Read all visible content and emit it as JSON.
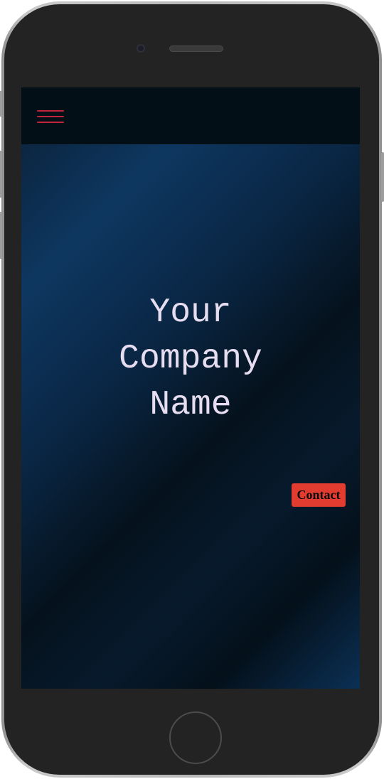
{
  "device": {
    "frame_color": "#b7b7b7",
    "bezel_color": "#232323"
  },
  "site": {
    "nav": {
      "menu_icon": "hamburger-menu-icon",
      "menu_icon_color": "#c0243c"
    },
    "hero": {
      "title_lines": [
        "Your",
        "Company",
        "Name"
      ],
      "title_color": "#e6ddf0"
    },
    "contact": {
      "label": "Contact",
      "color": "#e23b2f"
    }
  }
}
